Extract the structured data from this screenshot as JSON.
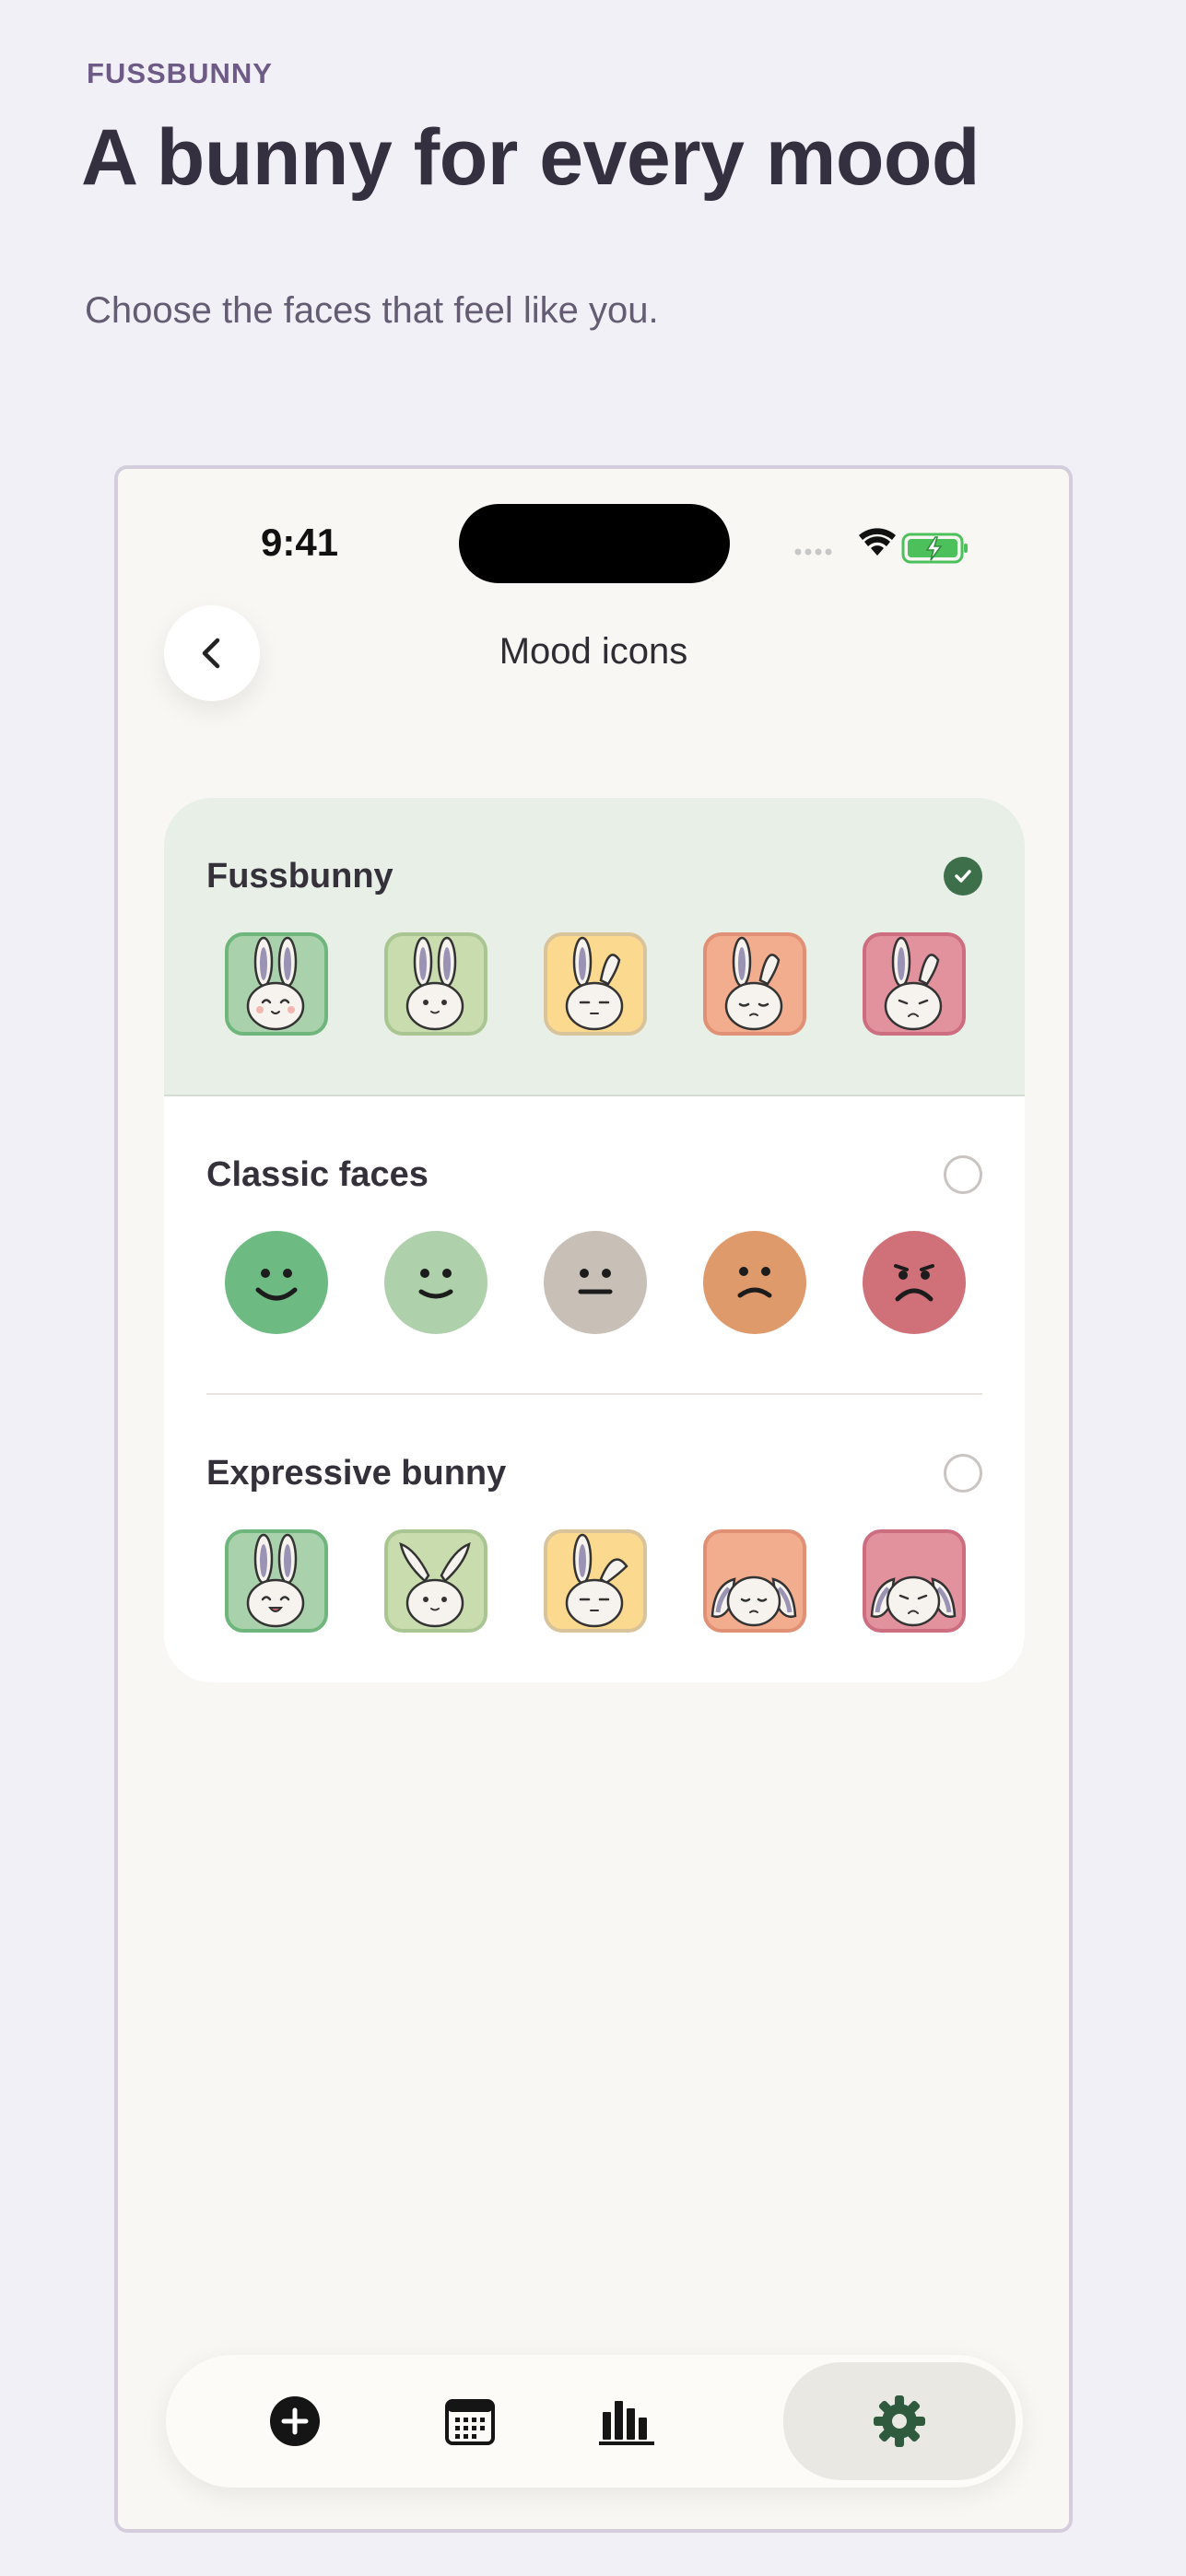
{
  "header": {
    "brand": "FUSSBUNNY",
    "headline": "A bunny for every mood",
    "subtitle": "Choose the faces that feel like you."
  },
  "status_bar": {
    "time": "9:41"
  },
  "screen": {
    "title": "Mood icons"
  },
  "options": [
    {
      "label": "Fussbunny",
      "selected": true,
      "style": "bunny-tiles"
    },
    {
      "label": "Classic faces",
      "selected": false,
      "style": "round-faces"
    },
    {
      "label": "Expressive bunny",
      "selected": false,
      "style": "expressive-bunny-tiles"
    }
  ],
  "mood_colors": {
    "tile_fill": [
      "#a9d2ac",
      "#c8dcad",
      "#fbd98f",
      "#f2ad8e",
      "#e2929d"
    ],
    "tile_border": [
      "#6fb67c",
      "#a9c591",
      "#d8c39a",
      "#e09074",
      "#cc6d80"
    ],
    "face_fill": [
      "#6dbb82",
      "#aed0ab",
      "#c8bfb6",
      "#df9a6c",
      "#d07179"
    ]
  },
  "tabbar": {
    "tabs": [
      "add-entry",
      "calendar",
      "stats",
      "settings"
    ],
    "active": "settings",
    "accent": "#2f5a3d"
  }
}
